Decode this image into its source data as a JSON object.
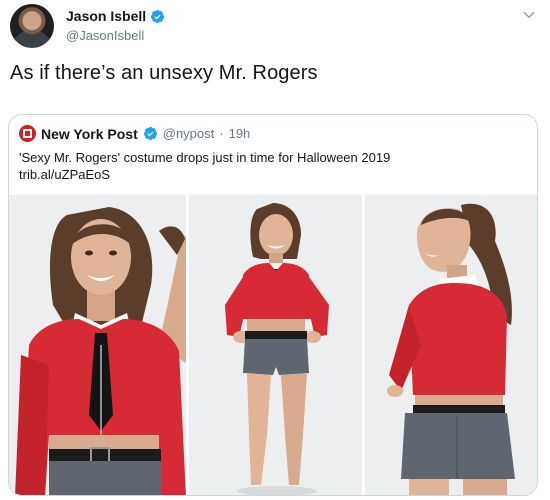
{
  "tweet": {
    "author_name": "Jason Isbell",
    "author_handle": "@JasonIsbell",
    "text": "As if there’s an unsexy Mr. Rogers"
  },
  "quoted_tweet": {
    "author_name": "New York Post",
    "author_handle": "@nypost",
    "separator": "·",
    "time": "19h",
    "text_line1": "'Sexy Mr. Rogers' costume drops just in time for Halloween 2019",
    "text_line2": "trib.al/uZPaEoS"
  },
  "colors": {
    "verified_blue": "#1da1f2",
    "brand_red": "#d21e27",
    "cardigan_red": "#d62b34",
    "shorts_gray": "#5f6670"
  },
  "icons": [
    "verified-badge-icon",
    "chevron-down-icon",
    "nypost-logo-icon"
  ]
}
